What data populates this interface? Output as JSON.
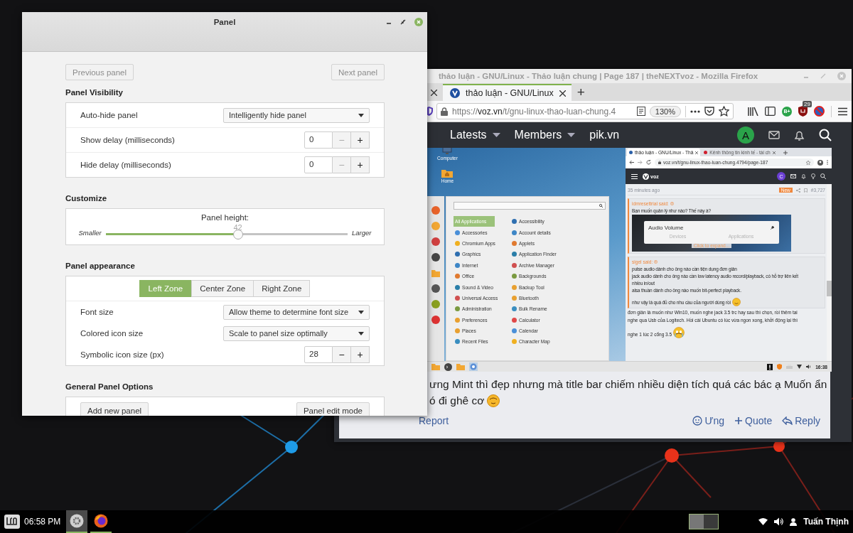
{
  "panel_window": {
    "title": "Panel",
    "nav": [
      {
        "label": "Previous panel",
        "disabled": true
      },
      {
        "label": "Next panel",
        "disabled": true
      }
    ],
    "sections": [
      {
        "heading": "Panel Visibility",
        "rows": [
          {
            "kind": "dropdown",
            "label": "Auto-hide panel",
            "value": "Intelligently hide panel"
          },
          {
            "kind": "spin",
            "label": "Show delay (milliseconds)",
            "value": "0",
            "minus": "−",
            "plus": "+",
            "minus_disabled": true
          },
          {
            "kind": "spin",
            "label": "Hide delay (milliseconds)",
            "value": "0",
            "minus": "−",
            "plus": "+",
            "minus_disabled": true
          }
        ]
      },
      {
        "heading": "Customize",
        "rows": [
          {
            "kind": "slider",
            "label": "Panel height:",
            "min_label": "Smaller",
            "max_label": "Larger",
            "value": "42",
            "level": 0.546
          }
        ]
      },
      {
        "heading": "Panel appearance",
        "rows": [
          {
            "kind": "zones",
            "zones": [
              {
                "label": "Left Zone",
                "selected": true
              },
              {
                "label": "Center Zone",
                "selected": false
              },
              {
                "label": "Right Zone",
                "selected": false
              }
            ]
          },
          {
            "kind": "dropdown",
            "label": "Font size",
            "value": "Allow theme to determine font size"
          },
          {
            "kind": "dropdown",
            "label": "Colored icon size",
            "value": "Scale to panel size optimally"
          },
          {
            "kind": "spin",
            "label": "Symbolic icon size (px)",
            "value": "28",
            "minus": "−",
            "plus": "+",
            "minus_disabled": false
          }
        ]
      },
      {
        "heading": "General Panel Options",
        "rows": [
          {
            "kind": "buttons",
            "buttons": [
              "Add new panel",
              "Panel edit mode"
            ]
          }
        ]
      }
    ]
  },
  "firefox_window": {
    "title": "thảo luận - GNU/Linux - Thảo luận chung | Page 187 | theNEXTvoz - Mozilla Firefox",
    "tabs": [
      {
        "selected": false
      },
      {
        "label": "thảo luận - GNU/Linux",
        "selected": true
      }
    ],
    "new_tab": "+",
    "url": {
      "scheme": "https://",
      "host": "voz.vn",
      "path": "/t/gnu-linux-thao-luan-chung.4"
    },
    "zoom": "130%",
    "extensions": [
      {
        "kind": "bplus",
        "label": "B+"
      },
      {
        "kind": "ublock",
        "badge": "29"
      },
      {
        "kind": "blocker"
      }
    ],
    "site_nav": [
      {
        "label": "Latests",
        "dropdown": true
      },
      {
        "label": "Members",
        "dropdown": true
      },
      {
        "label": "pik.vn",
        "dropdown": false
      }
    ],
    "avatar": "A",
    "post": {
      "screenshot": {
        "desktop_icons": [
          {
            "kind": "computer",
            "label": "Computer"
          },
          {
            "kind": "home",
            "label": "Home"
          }
        ],
        "menu": {
          "categories": [
            {
              "label": "All Applications",
              "selected": true
            },
            {
              "label": "Accessories",
              "selected": false
            },
            {
              "label": "Chromium Apps",
              "selected": false
            },
            {
              "label": "Graphics",
              "selected": false
            },
            {
              "label": "Internet",
              "selected": false
            },
            {
              "label": "Office",
              "selected": false
            },
            {
              "label": "Sound & Video",
              "selected": false
            },
            {
              "label": "Universal Access",
              "selected": false
            },
            {
              "label": "Administration",
              "selected": false
            },
            {
              "label": "Preferences",
              "selected": false
            },
            {
              "label": "Places",
              "selected": false
            },
            {
              "label": "Recent Files",
              "selected": false
            }
          ],
          "apps": [
            "Accessibility",
            "Account details",
            "Applets",
            "Application Finder",
            "Archive Manager",
            "Backgrounds",
            "Backup Tool",
            "Bluetooth",
            "Bulk Rename",
            "Calculator",
            "Calendar",
            "Character Map"
          ]
        },
        "browser": {
          "tabs": [
            {
              "label": "thảo luận - GNU/Linux - Thả",
              "selected": true
            },
            {
              "label": "Kênh thông tin kinh tế - tài ch",
              "selected": false
            }
          ],
          "url": "voz.vn/t/gnu-linux-thao-luan-chung.4794/page-187",
          "logo": "voz",
          "avatar": "C",
          "time": "35 minutes ago",
          "badge": "New",
          "number": "#3,727",
          "quotes": [
            {
              "author": "idmresettrial said:",
              "lines": [
                "Bạn muốn quản lý như nào? Thế này à?"
              ],
              "preview": {
                "title": "Audio Volume",
                "tabs": [
                  "Devices",
                  "Applications"
                ],
                "expand": "Click to expand..."
              }
            },
            {
              "author": "sigel said:",
              "lines": [
                "pulse audio dành cho ông nào cần tiện dụng đơn giản",
                "jack audio dành cho ông nào cần low latency audio record/playback, có hỗ trợ liên kết",
                "nhiều in/out",
                "alsa thuần dành cho ông nào muốn bit-perfect playback.",
                "như vậy là quá đủ cho nhu cầu của người dùng rồi"
              ]
            }
          ],
          "body": [
            "đơn giản là muốn như Win10, muốn nghe jack 3.5 trc hay sau thì chọn, rồi thêm tai",
            "nghe qua Usb của Logitech. Hồi cài Ubuntu có lúc vừa ngon xong, khởi động lại thì",
            "nghe 1 lúc 2 cổng 3.5"
          ]
        },
        "clock": "16:38"
      },
      "lines": [
        "ưng Mint thì đẹp nhưng mà title bar chiếm nhiều diện tích quá các bác ạ Muốn ẩn",
        "ó đi ghê cơ"
      ],
      "report": "Report",
      "actions": [
        {
          "kind": "react",
          "label": "Ưng"
        },
        {
          "kind": "quote",
          "label": "Quote"
        },
        {
          "kind": "reply",
          "label": "Reply"
        }
      ]
    }
  },
  "taskbar": {
    "clock": "06:58 PM",
    "apps": [
      {
        "kind": "settings",
        "selected": true
      },
      {
        "kind": "firefox",
        "selected": false
      }
    ],
    "workspaces": [
      {
        "selected": true
      },
      {
        "selected": false
      }
    ],
    "user": "Tuấn Thịnh"
  }
}
